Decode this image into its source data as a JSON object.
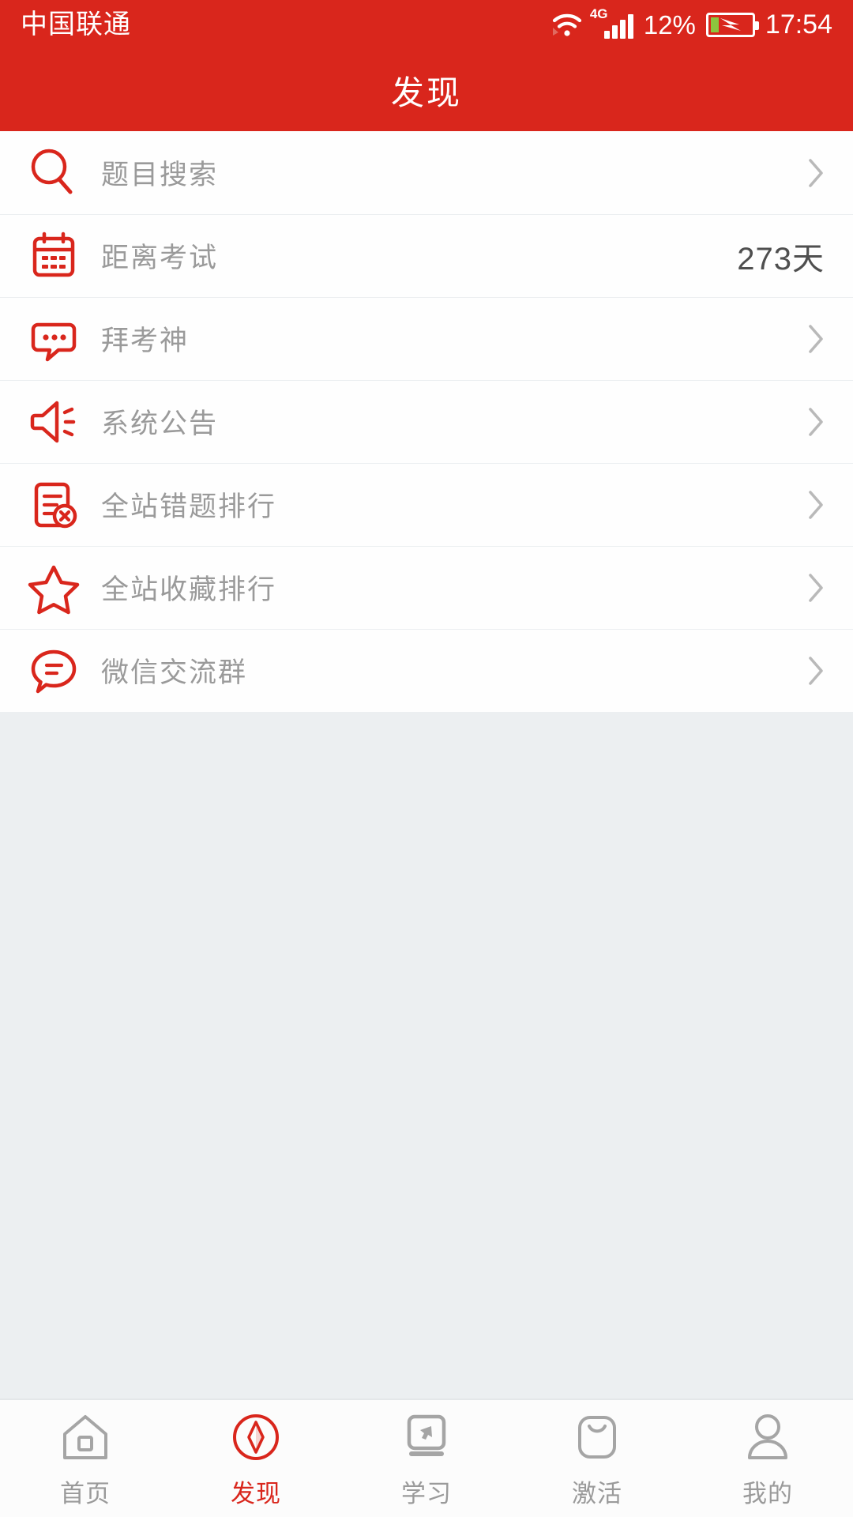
{
  "statusbar": {
    "carrier": "中国联通",
    "network_type": "4G",
    "battery_percent": "12%",
    "clock": "17:54",
    "wifi_icon": "wifi-icon",
    "signal_icon": "signal-bars-icon",
    "battery_icon": "battery-charging-icon"
  },
  "header": {
    "title": "发现"
  },
  "colors": {
    "brand_red": "#d9261c",
    "page_background": "#eceff1",
    "label_gray": "#9a9a9a",
    "value_dark": "#4f4f4f",
    "battery_green": "#8cc63e"
  },
  "list": {
    "rows": [
      {
        "label": "题目搜索",
        "icon": "search-icon",
        "value": "",
        "has_chevron": true
      },
      {
        "label": "距离考试",
        "icon": "calendar-icon",
        "value": "273天",
        "has_chevron": false
      },
      {
        "label": "拜考神",
        "icon": "chat-bubble-dots-icon",
        "value": "",
        "has_chevron": true
      },
      {
        "label": "系统公告",
        "icon": "speaker-announce-icon",
        "value": "",
        "has_chevron": true
      },
      {
        "label": "全站错题排行",
        "icon": "document-error-icon",
        "value": "",
        "has_chevron": true
      },
      {
        "label": "全站收藏排行",
        "icon": "star-icon",
        "value": "",
        "has_chevron": true
      },
      {
        "label": "微信交流群",
        "icon": "chat-bubble-lines-icon",
        "value": "",
        "has_chevron": true
      }
    ]
  },
  "tabbar": {
    "tabs": [
      {
        "label": "首页",
        "icon": "home-icon",
        "active": false
      },
      {
        "label": "发现",
        "icon": "compass-icon",
        "active": true
      },
      {
        "label": "学习",
        "icon": "monitor-cursor-icon",
        "active": false
      },
      {
        "label": "激活",
        "icon": "shopping-bag-icon",
        "active": false
      },
      {
        "label": "我的",
        "icon": "person-icon",
        "active": false
      }
    ]
  }
}
